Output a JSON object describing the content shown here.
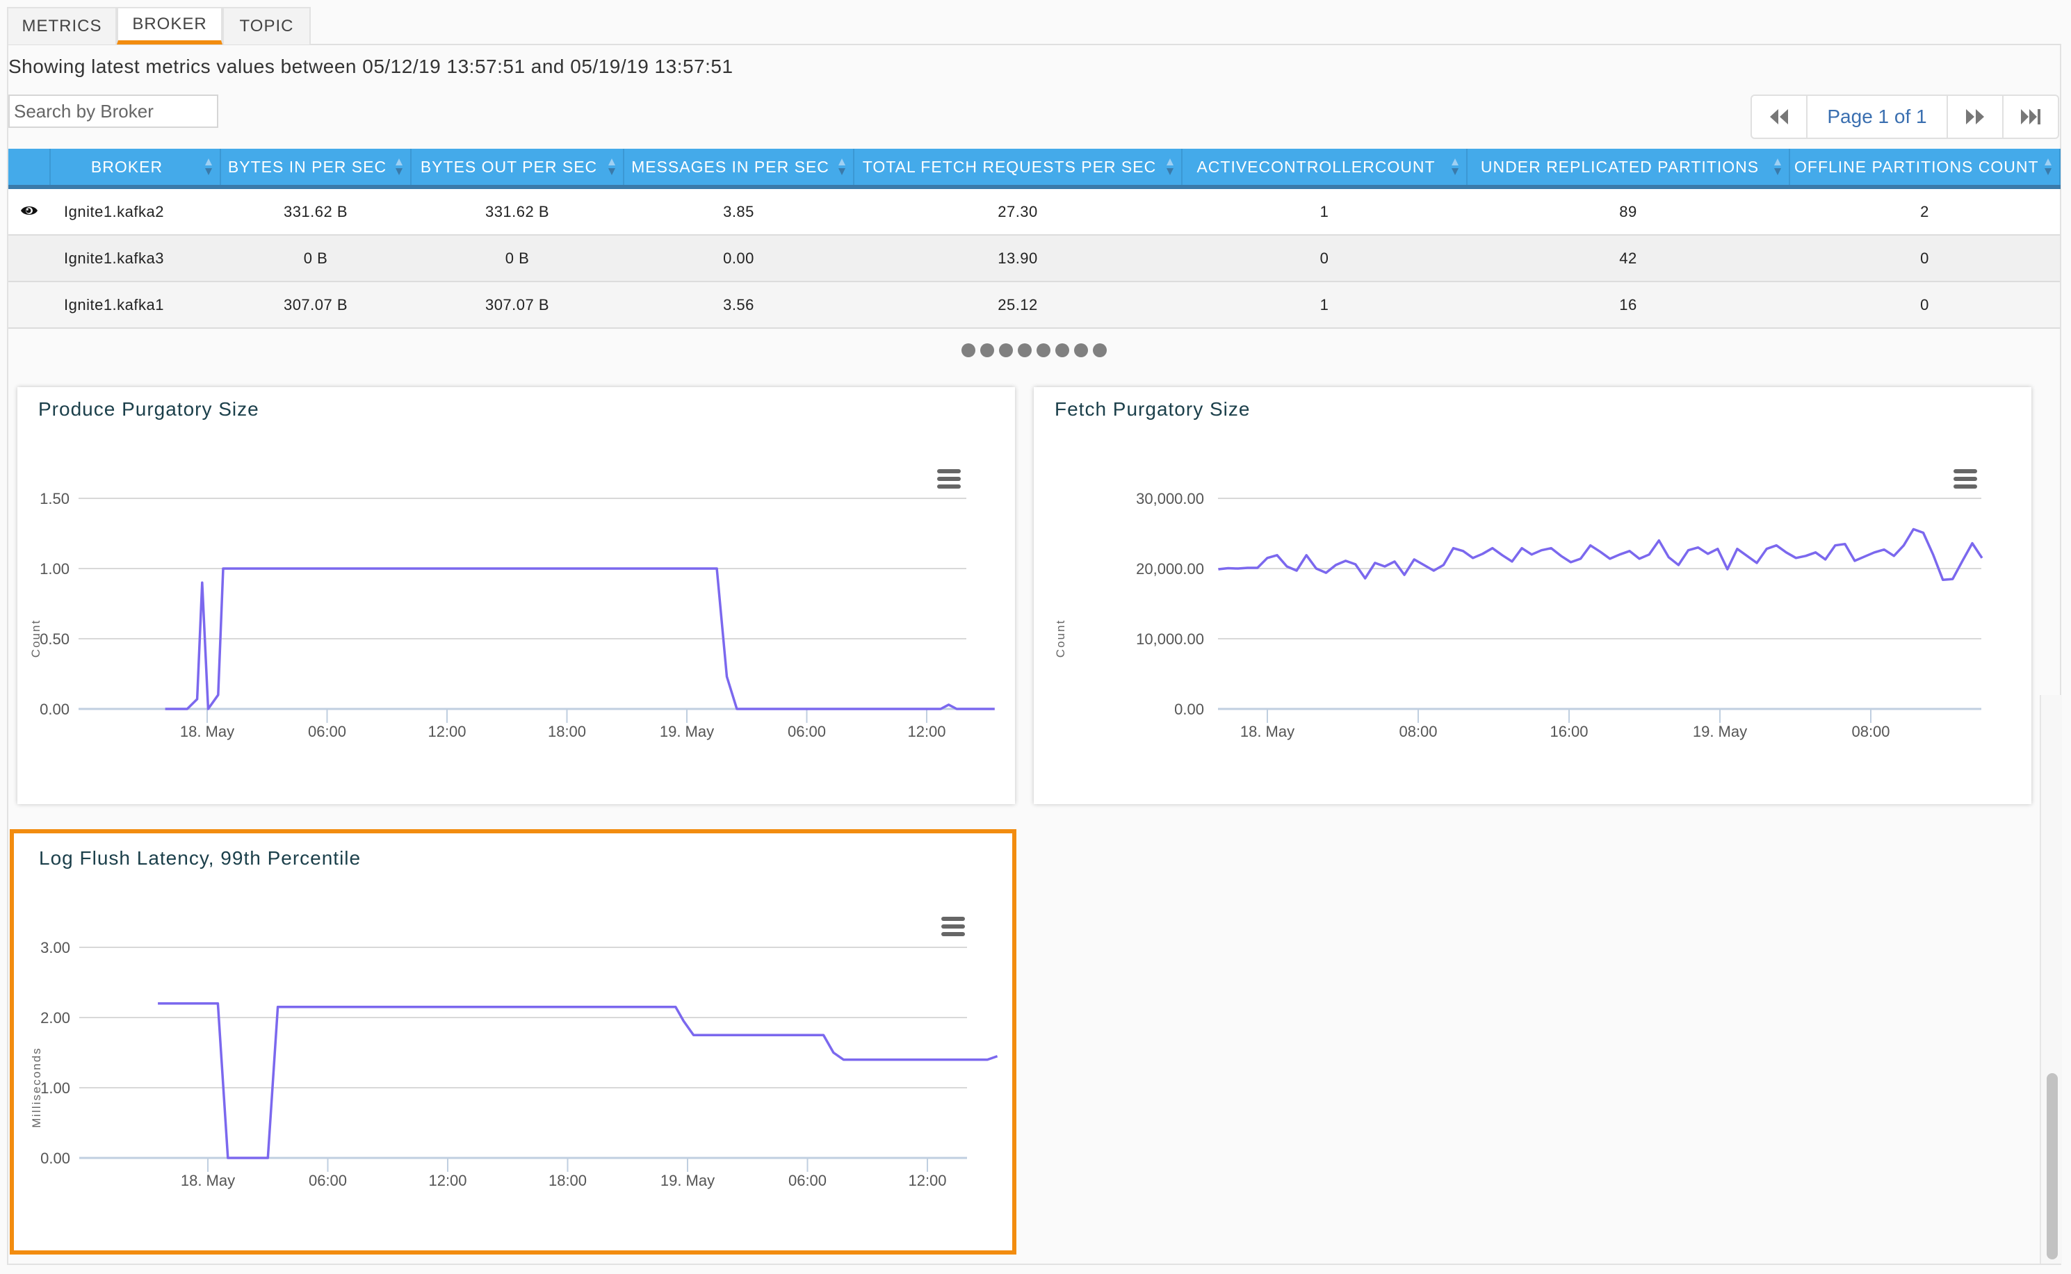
{
  "tabs": [
    {
      "label": "METRICS",
      "active": false
    },
    {
      "label": "BROKER",
      "active": true
    },
    {
      "label": "TOPIC",
      "active": false
    }
  ],
  "range_text": "Showing latest metrics values between 05/12/19 13:57:51 and 05/19/19 13:57:51",
  "search": {
    "placeholder": "Search by Broker",
    "value": ""
  },
  "pagination": {
    "label": "Page 1 of 1",
    "icons": [
      "first-page-icon",
      "next-page-icon",
      "last-page-icon"
    ]
  },
  "table": {
    "columns": [
      "",
      "BROKER",
      "BYTES IN PER SEC",
      "BYTES OUT PER SEC",
      "MESSAGES IN PER SEC",
      "TOTAL FETCH REQUESTS PER SEC",
      "ACTIVECONTROLLERCOUNT",
      "UNDER REPLICATED PARTITIONS",
      "OFFLINE PARTITIONS COUNT"
    ],
    "rows": [
      {
        "selected": true,
        "cells": [
          "Ignite1.kafka2",
          "331.62 B",
          "331.62 B",
          "3.85",
          "27.30",
          "1",
          "89",
          "2"
        ]
      },
      {
        "selected": false,
        "cells": [
          "Ignite1.kafka3",
          "0 B",
          "0 B",
          "0.00",
          "13.90",
          "0",
          "42",
          "0"
        ]
      },
      {
        "selected": false,
        "cells": [
          "Ignite1.kafka1",
          "307.07 B",
          "307.07 B",
          "3.56",
          "25.12",
          "1",
          "16",
          "0"
        ]
      }
    ]
  },
  "carousel_dots": 8,
  "colors": {
    "accent": "#f28c0f",
    "header": "#44aaea",
    "line": "#7b68ee",
    "title": "#1b3f4a"
  },
  "chart_data": [
    {
      "type": "line",
      "title": "Produce Purgatory Size",
      "ylabel": "Count",
      "xlabel": "",
      "ylim": [
        0,
        1.5
      ],
      "yticks": [
        "0.00",
        "0.50",
        "1.00",
        "1.50"
      ],
      "xticks": [
        "18. May",
        "06:00",
        "12:00",
        "18:00",
        "19. May",
        "06:00",
        "12:00"
      ],
      "xrange_hours": [
        -2.5,
        37.7
      ],
      "series": [
        {
          "name": "Count",
          "points": [
            [
              -2.1,
              0
            ],
            [
              -1.0,
              0
            ],
            [
              -0.5,
              0.07
            ],
            [
              -0.25,
              0.9
            ],
            [
              0.05,
              0
            ],
            [
              0.55,
              0.1
            ],
            [
              0.8,
              1.0
            ],
            [
              25.5,
              1.0
            ],
            [
              26.0,
              0.23
            ],
            [
              26.5,
              0
            ],
            [
              36.7,
              0
            ],
            [
              37.1,
              0.03
            ],
            [
              37.5,
              0
            ],
            [
              39.4,
              0
            ]
          ]
        }
      ],
      "grid": true,
      "legend": "none"
    },
    {
      "type": "line",
      "title": "Fetch Purgatory Size",
      "ylabel": "Count",
      "xlabel": "",
      "ylim": [
        0,
        30000
      ],
      "yticks": [
        "0.00",
        "10,000.00",
        "20,000.00",
        "30,000.00"
      ],
      "xticks": [
        "18. May",
        "08:00",
        "16:00",
        "19. May",
        "08:00"
      ],
      "xrange_hours": [
        -2.6,
        37.9
      ],
      "series": [
        {
          "name": "Count",
          "values": [
            19900,
            20050,
            20000,
            20100,
            20100,
            21500,
            21900,
            20300,
            19700,
            21900,
            20000,
            19400,
            20500,
            21100,
            20600,
            18600,
            20800,
            20300,
            21000,
            19100,
            21300,
            20500,
            19700,
            20500,
            22900,
            22500,
            21500,
            22100,
            22900,
            21900,
            21000,
            22900,
            22000,
            22600,
            22900,
            21800,
            20900,
            21400,
            23300,
            22400,
            21400,
            22000,
            22500,
            21400,
            22000,
            24000,
            21600,
            20500,
            22600,
            23000,
            22100,
            22800,
            19900,
            22800,
            21800,
            20800,
            22800,
            23300,
            22300,
            21500,
            21800,
            22300,
            21300,
            23300,
            23500,
            21100,
            21700,
            22300,
            22700,
            21800,
            23300,
            25600,
            25100,
            22000,
            18400,
            18500,
            21100,
            23600,
            21500
          ]
        }
      ],
      "grid": true,
      "legend": "none"
    },
    {
      "type": "line",
      "title": "Log Flush Latency, 99th Percentile",
      "ylabel": "Milliseconds",
      "xlabel": "",
      "ylim": [
        0,
        3
      ],
      "yticks": [
        "0.00",
        "1.00",
        "2.00",
        "3.00"
      ],
      "xticks": [
        "18. May",
        "06:00",
        "12:00",
        "18:00",
        "19. May",
        "06:00",
        "12:00"
      ],
      "xrange_hours": [
        -2.5,
        37.7
      ],
      "series": [
        {
          "name": "Milliseconds",
          "points": [
            [
              -2.5,
              2.2
            ],
            [
              0.5,
              2.2
            ],
            [
              1.0,
              0
            ],
            [
              3.0,
              0
            ],
            [
              3.5,
              2.15
            ],
            [
              23.4,
              2.15
            ],
            [
              23.8,
              1.95
            ],
            [
              24.3,
              1.75
            ],
            [
              30.8,
              1.75
            ],
            [
              31.3,
              1.5
            ],
            [
              31.8,
              1.4
            ],
            [
              39.0,
              1.4
            ],
            [
              39.5,
              1.45
            ]
          ]
        }
      ],
      "grid": true,
      "legend": "none"
    }
  ]
}
